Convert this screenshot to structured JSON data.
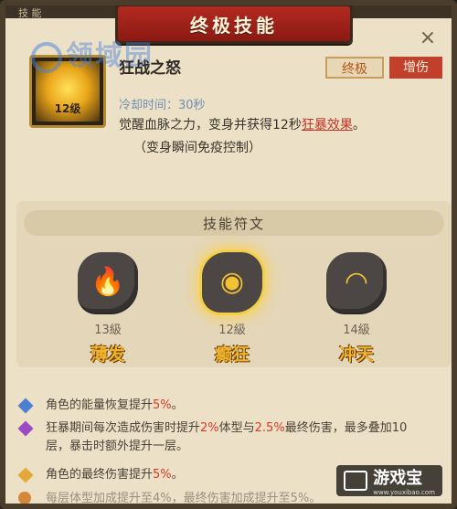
{
  "header": {
    "corner_left": "技 能",
    "title": "终极技能",
    "close": "×"
  },
  "watermark": "领域园",
  "skill": {
    "level_badge": "12级",
    "name": "狂战之怒",
    "tags": [
      "终极",
      "增伤"
    ],
    "cooldown": "冷却时间：30秒",
    "description_prefix": "觉醒血脉之力，变身并获得12秒",
    "description_highlight": "狂暴效果",
    "description_suffix": "。",
    "note": "（变身瞬间免疫控制）"
  },
  "runes": {
    "title": "技能符文",
    "items": [
      {
        "level": "13級",
        "name": "薄发",
        "symbol": "🔥",
        "active": false
      },
      {
        "level": "12級",
        "name": "癫狂",
        "symbol": "◉",
        "active": true
      },
      {
        "level": "14級",
        "name": "冲天",
        "symbol": "◠",
        "active": false
      }
    ]
  },
  "bonuses": [
    {
      "text_a": "角色的能量恢复提升",
      "pct": "5%",
      "text_b": "。",
      "icon": "blue-diamond-icon",
      "color": "#4b7fd1"
    },
    {
      "text_a": "狂暴期间每次造成伤害时提升",
      "pct": "2%",
      "text_b": "体型与",
      "pct2": "2.5%",
      "text_c": "最终伤害，最多叠加10层，暴击时额外提升一层。",
      "icon": "purple-diamond-icon",
      "color": "#9c4bc4"
    },
    {
      "text_a": "角色的最终伤害提升",
      "pct": "5%",
      "text_b": "。",
      "icon": "gold-diamond-icon",
      "color": "#e2a93a"
    },
    {
      "text_a": "每层体型加成提升至4%，最终伤害加成提升至5%。",
      "icon": "bag-icon",
      "color": "#d4883a"
    }
  ],
  "logo": {
    "name": "游戏宝",
    "url": "www.youxibao.com"
  }
}
